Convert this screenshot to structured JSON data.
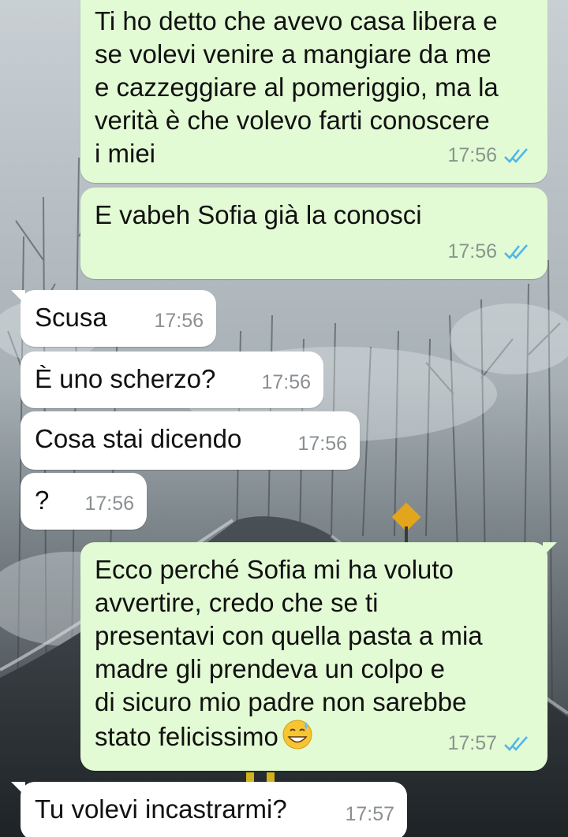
{
  "chat": {
    "messages": [
      {
        "direction": "outgoing",
        "text": "Ti ho detto che avevo casa libera e\nse volevi venire a mangiare da me\ne cazzeggiare al pomeriggio, ma la\nverità è che volevo farti conoscere\ni miei",
        "time": "17:56",
        "status": "read"
      },
      {
        "direction": "outgoing",
        "text": "E vabeh Sofia già la conosci",
        "time": "17:56",
        "status": "read"
      },
      {
        "direction": "incoming",
        "text": "Scusa",
        "time": "17:56"
      },
      {
        "direction": "incoming",
        "text": "È uno scherzo?",
        "time": "17:56"
      },
      {
        "direction": "incoming",
        "text": "Cosa stai dicendo",
        "time": "17:56"
      },
      {
        "direction": "incoming",
        "text": "?",
        "time": "17:56"
      },
      {
        "direction": "outgoing",
        "text": "Ecco perché Sofia mi ha voluto\navvertire, credo che se ti\npresentavi con quella pasta a mia\nmadre gli prendeva un colpo e\ndi sicuro mio padre non sarebbe\nstato felicissimo",
        "emoji": "grinning-face-with-sweat",
        "time": "17:57",
        "status": "read"
      },
      {
        "direction": "incoming",
        "text": "Tu volevi incastrarmi?",
        "time": "17:57"
      }
    ]
  },
  "colors": {
    "outgoing_bubble": "#e2fbd4",
    "incoming_bubble": "#ffffff",
    "read_ticks": "#4fb6ec",
    "timestamp": "#8a948e"
  }
}
